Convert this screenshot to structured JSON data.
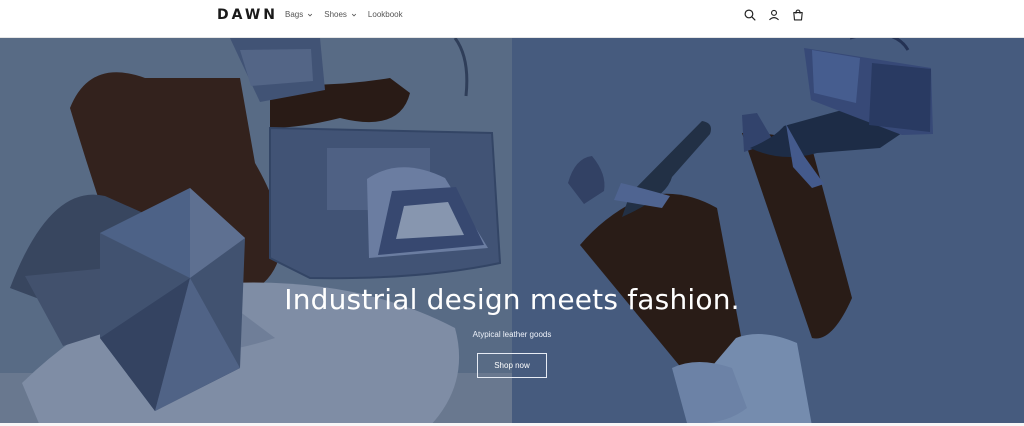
{
  "header": {
    "logo": "DAWN",
    "nav": [
      {
        "label": "Bags",
        "has_dropdown": true
      },
      {
        "label": "Shoes",
        "has_dropdown": true
      },
      {
        "label": "Lookbook",
        "has_dropdown": false
      }
    ],
    "icons": [
      "search-icon",
      "account-icon",
      "cart-icon"
    ]
  },
  "hero": {
    "title": "Industrial design meets fashion.",
    "subtitle": "Atypical leather goods",
    "button_label": "Shop now",
    "colors": {
      "left": "#5f7390",
      "right": "#4f668c"
    }
  }
}
